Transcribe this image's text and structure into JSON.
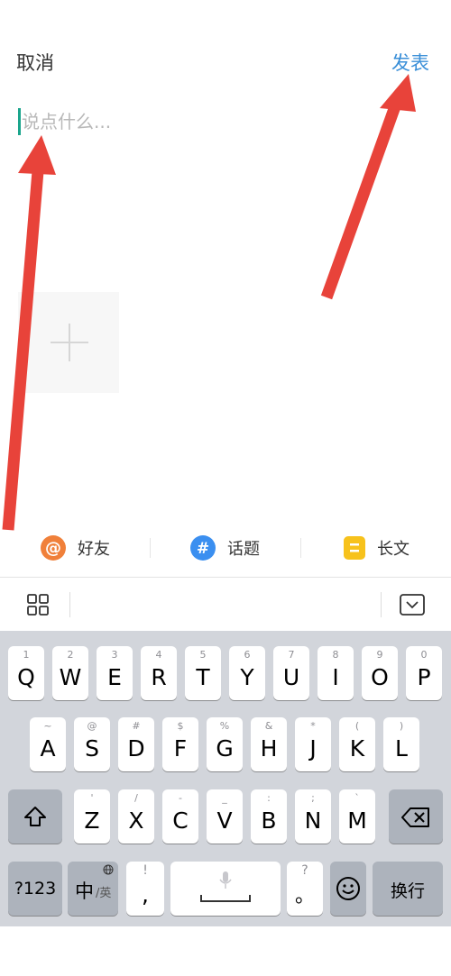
{
  "header": {
    "cancel_label": "取消",
    "publish_label": "发表"
  },
  "composer": {
    "placeholder": "说点什么..."
  },
  "shortcuts": [
    {
      "label": "好友",
      "icon": "at-icon",
      "color": "#f0803a"
    },
    {
      "label": "话题",
      "icon": "hashtag-icon",
      "color": "#3b8ff0"
    },
    {
      "label": "长文",
      "icon": "article-icon",
      "color": "#f7c21c"
    }
  ],
  "keyboard": {
    "row1": [
      {
        "sub": "1",
        "main": "Q"
      },
      {
        "sub": "2",
        "main": "W"
      },
      {
        "sub": "3",
        "main": "E"
      },
      {
        "sub": "4",
        "main": "R"
      },
      {
        "sub": "5",
        "main": "T"
      },
      {
        "sub": "6",
        "main": "Y"
      },
      {
        "sub": "7",
        "main": "U"
      },
      {
        "sub": "8",
        "main": "I"
      },
      {
        "sub": "9",
        "main": "O"
      },
      {
        "sub": "0",
        "main": "P"
      }
    ],
    "row2": [
      {
        "sub": "~",
        "main": "A"
      },
      {
        "sub": "@",
        "main": "S"
      },
      {
        "sub": "#",
        "main": "D"
      },
      {
        "sub": "$",
        "main": "F"
      },
      {
        "sub": "%",
        "main": "G"
      },
      {
        "sub": "&",
        "main": "H"
      },
      {
        "sub": "*",
        "main": "J"
      },
      {
        "sub": "(",
        "main": "K"
      },
      {
        "sub": ")",
        "main": "L"
      }
    ],
    "row3": [
      {
        "sub": "'",
        "main": "Z"
      },
      {
        "sub": "/",
        "main": "X"
      },
      {
        "sub": "-",
        "main": "C"
      },
      {
        "sub": "_",
        "main": "V"
      },
      {
        "sub": ":",
        "main": "B"
      },
      {
        "sub": ";",
        "main": "N"
      },
      {
        "sub": "`",
        "main": "M"
      }
    ],
    "numbers_label": "?123",
    "lang_label": "中",
    "lang_sub": "/英",
    "punct_sub": "!",
    "punct_main": ",",
    "period_sub": "?",
    "period_main": "。",
    "return_label": "换行"
  }
}
